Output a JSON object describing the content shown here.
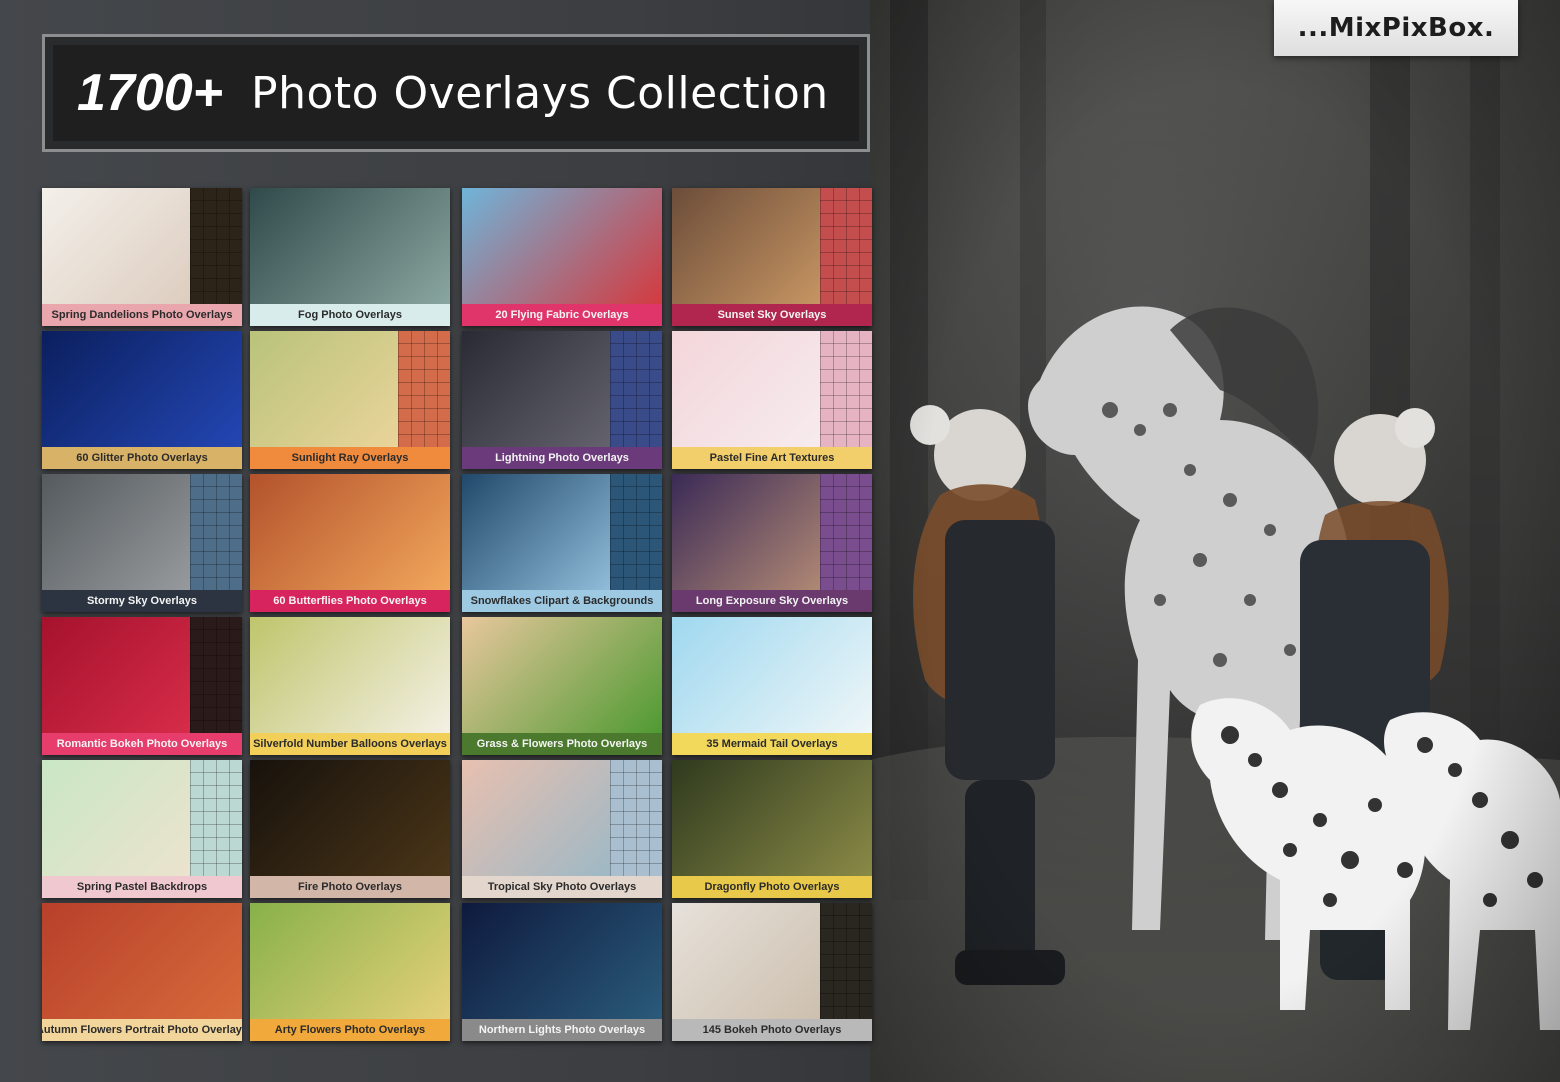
{
  "brand": {
    "logo_text": "...MixPixBox."
  },
  "banner": {
    "count": "1700+",
    "title": "Photo Overlays Collection"
  },
  "tiles": [
    {
      "caption": "Spring Dandelions Photo Overlays",
      "caption_bg": "#e9a7ad",
      "photo": [
        "#f3f0ea",
        "#d9c6b7"
      ],
      "thumbs": "#2c2418"
    },
    {
      "caption": "Fog Photo Overlays",
      "caption_bg": "#d8ecec",
      "photo": [
        "#2f4a4a",
        "#8aa6a0"
      ],
      "thumbs": ""
    },
    {
      "caption": "20 Flying Fabric Overlays",
      "caption_bg": "#e0356a",
      "photo": [
        "#6fb4d9",
        "#d43a3f"
      ],
      "thumbs": ""
    },
    {
      "caption": "Sunset Sky Overlays",
      "caption_bg": "#b0264e",
      "photo": [
        "#6c4d3a",
        "#d8a36a"
      ],
      "thumbs": "#c44d4d"
    },
    {
      "caption": "60 Glitter Photo Overlays",
      "caption_bg": "#d8b267",
      "photo": [
        "#0b1f5e",
        "#2346b3"
      ],
      "thumbs": ""
    },
    {
      "caption": "Sunlight Ray Overlays",
      "caption_bg": "#f08a3c",
      "photo": [
        "#b9c37a",
        "#f3d7a0"
      ],
      "thumbs": "#d36c4b"
    },
    {
      "caption": "Lightning Photo Overlays",
      "caption_bg": "#6b3a7a",
      "photo": [
        "#2a2a35",
        "#6f6e78"
      ],
      "thumbs": "#3a4b8a"
    },
    {
      "caption": "Pastel Fine Art Textures",
      "caption_bg": "#f3cf6b",
      "photo": [
        "#f3d6da",
        "#f7eff2"
      ],
      "thumbs": "#e6b3c2"
    },
    {
      "caption": "Stormy Sky Overlays",
      "caption_bg": "#2b3440",
      "photo": [
        "#555a5e",
        "#a3a7aa"
      ],
      "thumbs": "#4d6d89"
    },
    {
      "caption": "60 Butterflies Photo Overlays",
      "caption_bg": "#d8245e",
      "photo": [
        "#b3522c",
        "#f2a75c"
      ],
      "thumbs": ""
    },
    {
      "caption": "Snowflakes Clipart & Backgrounds",
      "caption_bg": "#9ec9e3",
      "photo": [
        "#20486a",
        "#a7d3ef"
      ],
      "thumbs": "#2b5678"
    },
    {
      "caption": "Long Exposure Sky Overlays",
      "caption_bg": "#6a3a6e",
      "photo": [
        "#3a2a56",
        "#c79a7a"
      ],
      "thumbs": "#7a4e8e"
    },
    {
      "caption": "Romantic Bokeh Photo Overlays",
      "caption_bg": "#e63d6d",
      "photo": [
        "#a5122d",
        "#e0314e"
      ],
      "thumbs": "#2b1a1a"
    },
    {
      "caption": "Silverfold Number Balloons Overlays",
      "caption_bg": "#f2cf59",
      "photo": [
        "#bfc56c",
        "#f4f0e4"
      ],
      "thumbs": ""
    },
    {
      "caption": "Grass & Flowers Photo Overlays",
      "caption_bg": "#4b7a2e",
      "photo": [
        "#e8c79d",
        "#4f9a32"
      ],
      "thumbs": ""
    },
    {
      "caption": "35 Mermaid Tail Overlays",
      "caption_bg": "#f2d85b",
      "photo": [
        "#9fd8ef",
        "#eef6f8"
      ],
      "thumbs": ""
    },
    {
      "caption": "Spring Pastel Backdrops",
      "caption_bg": "#f0c8cf",
      "photo": [
        "#c9e7c5",
        "#f2e2cf"
      ],
      "thumbs": "#bcd8d2"
    },
    {
      "caption": "Fire Photo Overlays",
      "caption_bg": "#d2b7a9",
      "photo": [
        "#17120c",
        "#4a3518"
      ],
      "thumbs": ""
    },
    {
      "caption": "Tropical Sky Photo Overlays",
      "caption_bg": "#e3d6cc",
      "photo": [
        "#e8c0b0",
        "#8fb7c9"
      ],
      "thumbs": "#a9bfd0"
    },
    {
      "caption": "Dragonfly Photo Overlays",
      "caption_bg": "#e9c94a",
      "photo": [
        "#2f3a1e",
        "#8a8a46"
      ],
      "thumbs": ""
    },
    {
      "caption": "Autumn Flowers Portrait Photo Overlays",
      "caption_bg": "#f2d59a",
      "photo": [
        "#b8402b",
        "#d66a3a"
      ],
      "thumbs": ""
    },
    {
      "caption": "Arty Flowers Photo Overlays",
      "caption_bg": "#f0a93a",
      "photo": [
        "#88b14a",
        "#e4d07a"
      ],
      "thumbs": ""
    },
    {
      "caption": "Northern Lights Photo Overlays",
      "caption_bg": "#8a8a8a",
      "photo": [
        "#0e1a3e",
        "#2a5a7a"
      ],
      "thumbs": ""
    },
    {
      "caption": "145 Bokeh Photo Overlays",
      "caption_bg": "#b9b9b9",
      "photo": [
        "#e6e1da",
        "#c8b9a6"
      ],
      "thumbs": "#2a2620"
    }
  ]
}
